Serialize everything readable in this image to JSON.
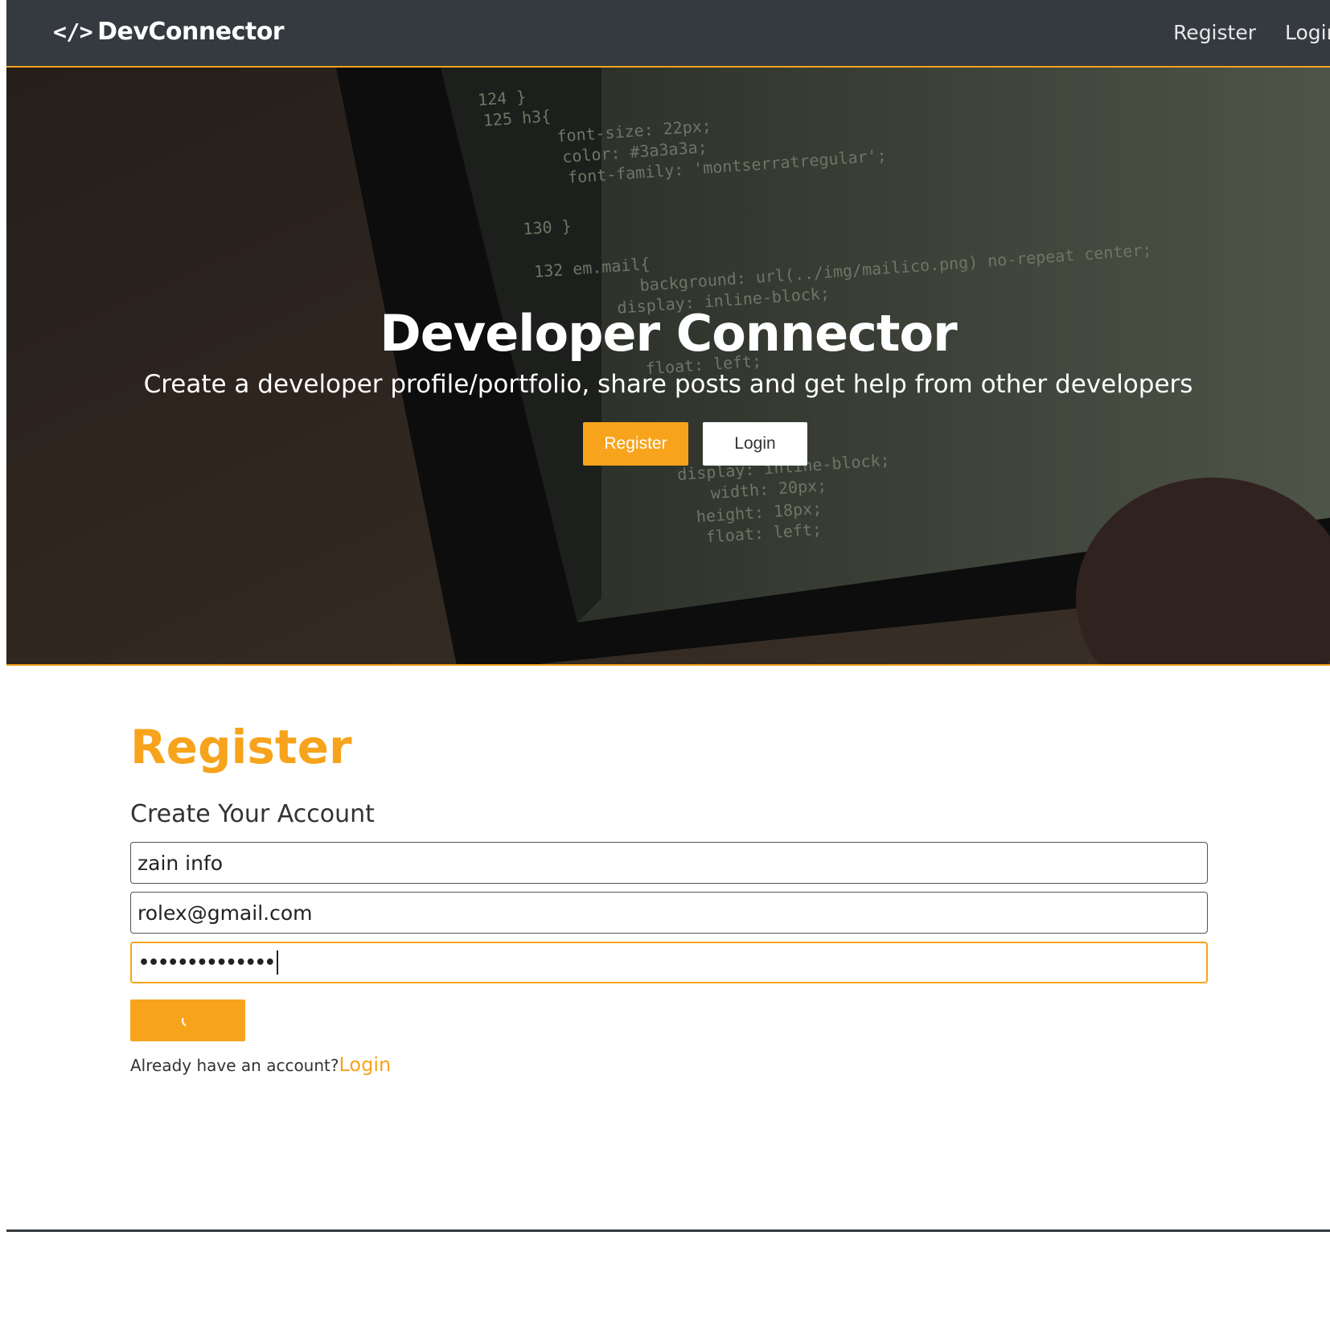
{
  "navbar": {
    "brand_icon": "</>",
    "brand": "DevConnector",
    "links": [
      "Register",
      "Login"
    ]
  },
  "hero": {
    "title": "Developer Connector",
    "subtitle": "Create a developer profile/portfolio, share posts and get help from other developers",
    "register_label": "Register",
    "login_label": "Login",
    "background_code": [
      "124 }",
      "125 h3{",
      "font-size: 22px;",
      "color: #3a3a3a;",
      "font-family: 'montserratregular';",
      "130 }",
      "132 em.mail{",
      "background: url(../img/mailico.png) no-repeat center;",
      "display: inline-block;",
      "float: left;",
      "display: inline-block;",
      "width: 20px;",
      "height: 18px;",
      "float: left;"
    ]
  },
  "form": {
    "heading": "Register",
    "lead": "Create Your Account",
    "name_value": "zain info",
    "email_value": "rolex@gmail.com",
    "password_mask": "••••••••••••••",
    "signin_text": "Already have an account?",
    "signin_link": "Login"
  },
  "colors": {
    "accent": "#f7a31c",
    "navbar": "#343a40"
  }
}
